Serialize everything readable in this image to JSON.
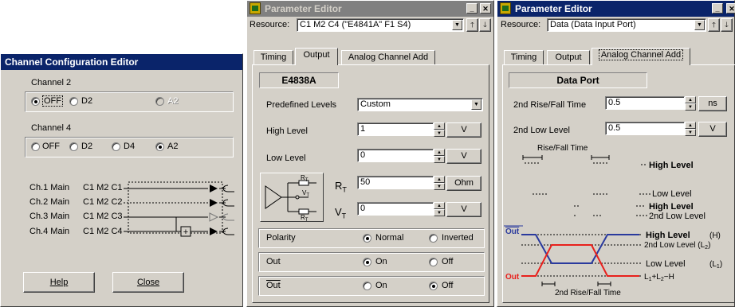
{
  "channel_editor": {
    "title": "Channel Configuration Editor",
    "channel2": {
      "label": "Channel 2",
      "options": [
        "OFF",
        "D2",
        "A2"
      ],
      "selected": "OFF"
    },
    "channel4": {
      "label": "Channel 4",
      "options": [
        "OFF",
        "D2",
        "D4",
        "A2"
      ],
      "selected": "A2"
    },
    "rows": [
      {
        "name": "Ch.1 Main",
        "id": "C1 M2 C1"
      },
      {
        "name": "Ch.2 Main",
        "id": "C1 M2 C2"
      },
      {
        "name": "Ch.3 Main",
        "id": "C1 M2 C3"
      },
      {
        "name": "Ch.4 Main",
        "id": "C1 M2 C4"
      }
    ],
    "combiner_symbol": "+",
    "help_label": "Help",
    "close_label": "Close"
  },
  "pe1": {
    "title": "Parameter Editor",
    "resource_label": "Resource:",
    "resource_value": "C1 M2 C4 (\"E4841A\" F1 S4)",
    "tabs": [
      "Timing",
      "Output",
      "Analog Channel Add"
    ],
    "active_tab": "Output",
    "header": "E4838A",
    "predefined_label": "Predefined Levels",
    "predefined_value": "Custom",
    "high_label": "High Level",
    "high_value": "1",
    "high_unit": "V",
    "low_label": "Low Level",
    "low_value": "0",
    "low_unit": "V",
    "rt_label": "R",
    "rt_sub": "T",
    "rt_value": "50",
    "rt_unit": "Ohm",
    "vt_label": "V",
    "vt_sub": "T",
    "vt_value": "0",
    "vt_unit": "V",
    "circuit": {
      "r_top": "R",
      "r_top_sub": "T",
      "v": "V",
      "v_sub": "T",
      "r_bot": "R",
      "r_bot_sub": "T"
    },
    "polarity": {
      "label": "Polarity",
      "options": [
        "Normal",
        "Inverted"
      ],
      "selected": "Normal"
    },
    "out": {
      "label": "Out",
      "options": [
        "On",
        "Off"
      ],
      "selected": "On"
    },
    "outbar": {
      "label": "Out",
      "options": [
        "On",
        "Off"
      ],
      "selected": "Off"
    }
  },
  "pe2": {
    "title": "Parameter Editor",
    "resource_label": "Resource:",
    "resource_value": "Data (Data Input Port)",
    "tabs": [
      "Timing",
      "Output",
      "Analog Channel Add"
    ],
    "active_tab": "Analog Channel Add",
    "header": "Data Port",
    "rise_label": "2nd Rise/Fall Time",
    "rise_value": "0.5",
    "rise_unit": "ns",
    "low_label": "2nd Low Level",
    "low_value": "0.5",
    "low_unit": "V",
    "diagram": {
      "rise_fall_top": "Rise/Fall Time",
      "high_level": "High Level",
      "low_level": "Low Level",
      "second_low": "2nd Low Level",
      "out": "Out",
      "h": "(H)",
      "second_low_l2": "2nd Low Level (L",
      "l2_sub": "2",
      "l1": "(L",
      "l1_sub": "1",
      "sum": "L",
      "sum_rest": "+L",
      "sum_rest2": "−H",
      "second_rise": "2nd Rise/Fall Time"
    },
    "colors": {
      "red": "#e8201c",
      "blue": "#2a3a9e"
    }
  }
}
